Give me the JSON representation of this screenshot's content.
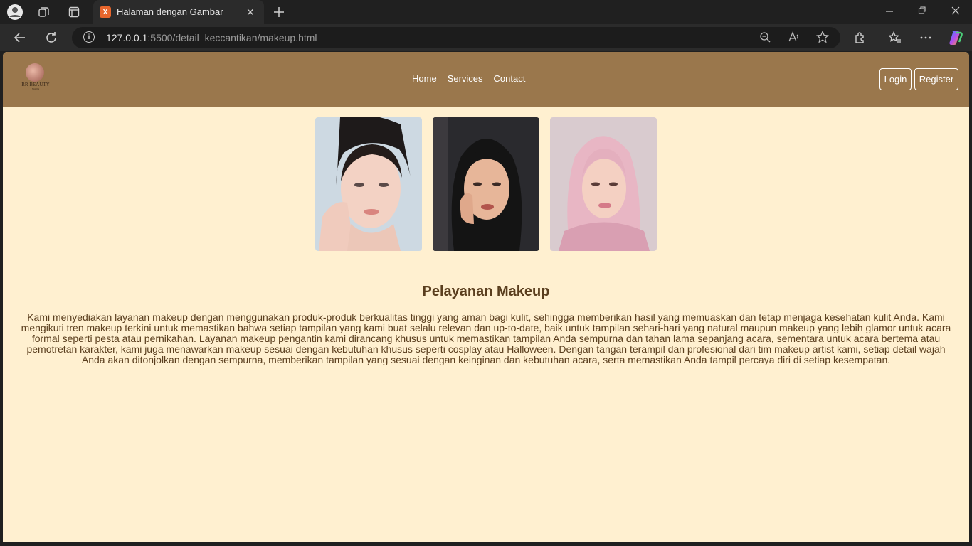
{
  "browser": {
    "tab_title": "Halaman dengan Gambar",
    "tab_favicon_text": "X",
    "url_host": "127.0.0.1",
    "url_path": ":5500/detail_keccantikan/makeup.html"
  },
  "site": {
    "logo_text": "RR BEAUTY",
    "logo_sub": "SALON",
    "nav": {
      "home": "Home",
      "services": "Services",
      "contact": "Contact"
    },
    "login_label": "Login",
    "register_label": "Register"
  },
  "content": {
    "title": "Pelayanan Makeup",
    "description": "Kami menyediakan layanan makeup dengan menggunakan produk-produk berkualitas tinggi yang aman bagi kulit, sehingga memberikan hasil yang memuaskan dan tetap menjaga kesehatan kulit Anda. Kami mengikuti tren makeup terkini untuk memastikan bahwa setiap tampilan yang kami buat selalu relevan dan up-to-date, baik untuk tampilan sehari-hari yang natural maupun makeup yang lebih glamor untuk acara formal seperti pesta atau pernikahan. Layanan makeup pengantin kami dirancang khusus untuk memastikan tampilan Anda sempurna dan tahan lama sepanjang acara, sementara untuk acara bertema atau pemotretan karakter, kami juga menawarkan makeup sesuai dengan kebutuhan khusus seperti cosplay atau Halloween. Dengan tangan terampil dan profesional dari tim makeup artist kami, setiap detail wajah Anda akan ditonjolkan dengan sempurna, memberikan tampilan yang sesuai dengan keinginan dan kebutuhan acara, serta memastikan Anda tampil percaya diri di setiap kesempatan."
  },
  "colors": {
    "header": "#9a774c",
    "page_bg": "#fff0d0",
    "text": "#5a3e1e"
  }
}
